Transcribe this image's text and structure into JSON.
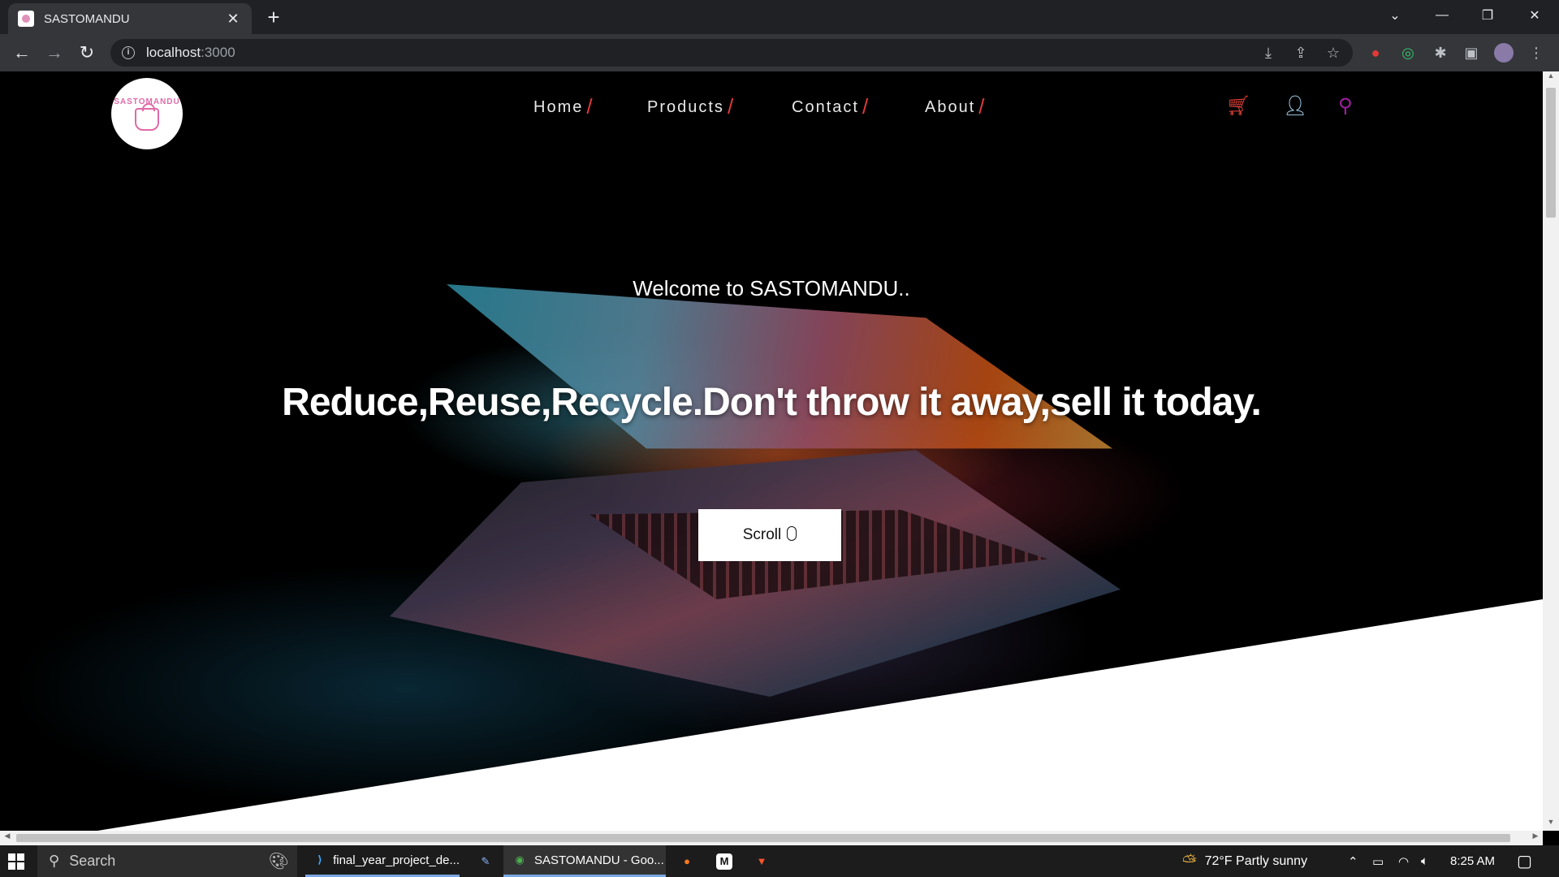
{
  "browser": {
    "tab_title": "SASTOMANDU",
    "url_host": "localhost",
    "url_port": ":3000"
  },
  "site": {
    "logo_text": "SASTOMANDU",
    "nav": [
      {
        "label": "Home"
      },
      {
        "label": "Products"
      },
      {
        "label": "Contact"
      },
      {
        "label": "About"
      }
    ],
    "welcome": "Welcome to SASTOMANDU..",
    "headline": "Reduce,Reuse,Recycle.Don't throw it away,sell it today.",
    "scroll_label": "Scroll",
    "colors": {
      "accent_slash": "#e03a3a",
      "cart_icon": "#e8423a",
      "user_icon": "#a9d8f5",
      "search_icon": "#a020a0"
    }
  },
  "taskbar": {
    "search_placeholder": "Search",
    "apps": [
      {
        "label": "final_year_project_de..."
      },
      {
        "label": "SASTOMANDU - Goo..."
      }
    ],
    "weather": "72°F  Partly sunny",
    "time": "8:25 AM"
  }
}
